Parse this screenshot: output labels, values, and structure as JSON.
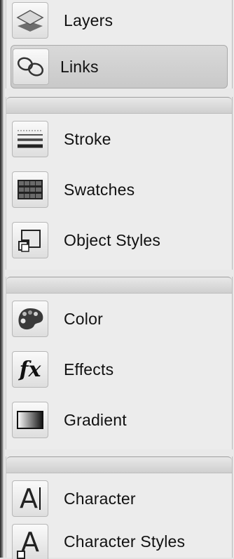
{
  "panels": {
    "group1": {
      "items": [
        {
          "label": "Layers",
          "icon": "layers-icon"
        },
        {
          "label": "Links",
          "icon": "links-icon",
          "selected": true
        }
      ]
    },
    "group2": {
      "items": [
        {
          "label": "Stroke",
          "icon": "stroke-icon"
        },
        {
          "label": "Swatches",
          "icon": "swatches-icon"
        },
        {
          "label": "Object Styles",
          "icon": "object-styles-icon"
        }
      ]
    },
    "group3": {
      "items": [
        {
          "label": "Color",
          "icon": "color-palette-icon"
        },
        {
          "label": "Effects",
          "icon": "effects-fx-icon",
          "glyph": "fx"
        },
        {
          "label": "Gradient",
          "icon": "gradient-icon"
        }
      ]
    },
    "group4": {
      "items": [
        {
          "label": "Character",
          "icon": "character-icon",
          "glyph": "A"
        },
        {
          "label": "Character Styles",
          "icon": "character-styles-icon",
          "glyph": "A"
        }
      ]
    }
  },
  "colors": {
    "background": "#e9e9e9",
    "selected": "#cfcfcf",
    "text": "#111111"
  }
}
